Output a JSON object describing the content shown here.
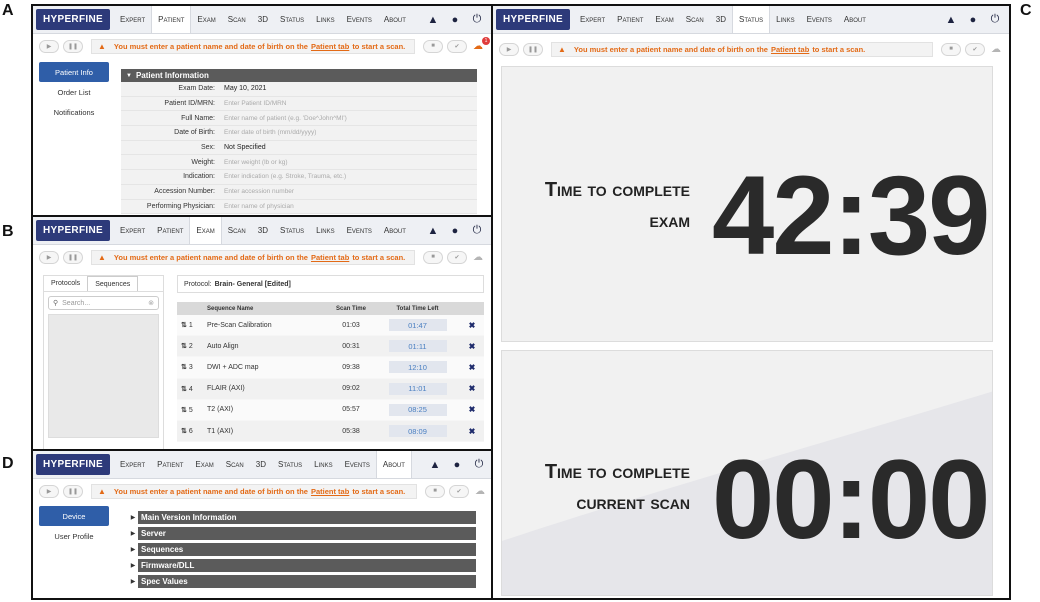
{
  "labels": {
    "a": "A",
    "b": "B",
    "c": "C",
    "d": "D"
  },
  "app": {
    "logo": "HYPERFINE",
    "nav": [
      "Expert",
      "Patient",
      "Exam",
      "Scan",
      "3D",
      "Status",
      "Links",
      "Events",
      "About"
    ],
    "warning_before": "You must enter a patient name and date of birth on the",
    "warning_link": "Patient tab",
    "warning_after": "to start a scan.",
    "cloud_badge": "1"
  },
  "panel_a": {
    "side": [
      "Patient Info",
      "Order List",
      "Notifications"
    ],
    "section": "Patient Information",
    "fields": [
      {
        "label": "Exam Date:",
        "value": "May 10, 2021"
      },
      {
        "label": "Patient ID/MRN:",
        "value": "Enter Patient ID/MRN"
      },
      {
        "label": "Full Name:",
        "value": "Enter name of patient (e.g. 'Doe^John^MI')"
      },
      {
        "label": "Date of Birth:",
        "value": "Enter date of birth (mm/dd/yyyy)"
      },
      {
        "label": "Sex:",
        "value": "Not Specified"
      },
      {
        "label": "Weight:",
        "value": "Enter weight (lb or kg)"
      },
      {
        "label": "Indication:",
        "value": "Enter indication (e.g. Stroke, Trauma, etc.)"
      },
      {
        "label": "Accession Number:",
        "value": "Enter accession number"
      },
      {
        "label": "Performing Physician:",
        "value": "Enter name of physician"
      }
    ]
  },
  "panel_b": {
    "tabs": [
      "Protocols",
      "Sequences"
    ],
    "search_placeholder": "Search...",
    "protocol_label": "Protocol:",
    "protocol_name": "Brain- General [Edited]",
    "columns": [
      "Sequence Name",
      "Scan Time",
      "Total Time Left"
    ],
    "rows": [
      {
        "num": "1",
        "name": "Pre-Scan Calibration",
        "scan": "01:03",
        "left": "01:47"
      },
      {
        "num": "2",
        "name": "Auto Align",
        "scan": "00:31",
        "left": "01:11"
      },
      {
        "num": "3",
        "name": "DWI + ADC map",
        "scan": "09:38",
        "left": "12:10"
      },
      {
        "num": "4",
        "name": "FLAIR (AXI)",
        "scan": "09:02",
        "left": "11:01"
      },
      {
        "num": "5",
        "name": "T2 (AXI)",
        "scan": "05:57",
        "left": "08:25"
      },
      {
        "num": "6",
        "name": "T1 (AXI)",
        "scan": "05:38",
        "left": "08:09"
      }
    ]
  },
  "panel_c": {
    "exam_title_1": "Time to complete",
    "exam_title_2": "exam",
    "exam_time": "42:39",
    "scan_title_1": "Time to complete",
    "scan_title_2": "current scan",
    "scan_time": "00:00"
  },
  "panel_d": {
    "side": [
      "Device",
      "User Profile"
    ],
    "sections": [
      "Main Version Information",
      "Server",
      "Sequences",
      "Firmware/DLL",
      "Spec Values"
    ]
  }
}
